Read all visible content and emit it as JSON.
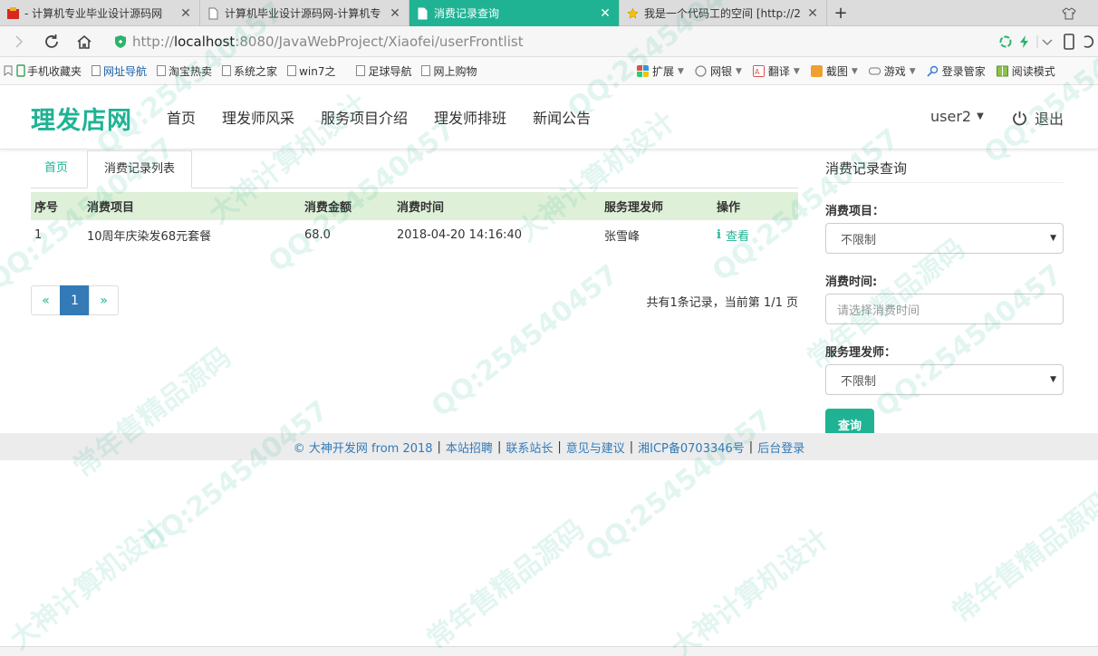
{
  "browser": {
    "tabs": [
      {
        "title": "- 计算机专业毕业设计源码网",
        "active": false
      },
      {
        "title": "计算机毕业设计源码网-计算机专",
        "active": false
      },
      {
        "title": "消费记录查询",
        "active": true
      },
      {
        "title": "我是一个代码工的空间 [http://2",
        "active": false
      }
    ],
    "new_tab": "+",
    "url_prefix": "http://",
    "url_host": "localhost",
    "url_rest": ":8080/JavaWebProject/Xiaofei/userFrontlist"
  },
  "bookmarks": {
    "left": [
      "手机收藏夹",
      "网址导航",
      "淘宝热卖",
      "系统之家",
      "win7之",
      "足球导航",
      "网上购物"
    ],
    "right": [
      "扩展",
      "网银",
      "翻译",
      "截图",
      "游戏",
      "登录管家",
      "阅读模式"
    ]
  },
  "site": {
    "brand": "理发店网",
    "nav": [
      "首页",
      "理发师风采",
      "服务项目介绍",
      "理发师排班",
      "新闻公告"
    ],
    "user": "user2",
    "logout": "退出"
  },
  "content_tabs": {
    "home": "首页",
    "current": "消费记录列表"
  },
  "table": {
    "headers": [
      "序号",
      "消费项目",
      "消费金额",
      "消费时间",
      "服务理发师",
      "操作"
    ],
    "rows": [
      {
        "no": "1",
        "item": "10周年庆染发68元套餐",
        "amount": "68.0",
        "time": "2018-04-20 14:16:40",
        "barber": "张雪峰",
        "action": "查看"
      }
    ]
  },
  "pager": {
    "prev": "«",
    "current": "1",
    "next": "»",
    "info": "共有1条记录，当前第 1/1 页"
  },
  "sidebar": {
    "title": "消费记录查询",
    "item_label": "消费项目：",
    "item_value": "不限制",
    "time_label": "消费时间:",
    "time_placeholder": "请选择消费时间",
    "barber_label": "服务理发师：",
    "barber_value": "不限制",
    "query_button": "查询"
  },
  "footer": {
    "links": [
      "© 大神开发网 from 2018",
      "本站招聘",
      "联系站长",
      "意见与建议",
      "湘ICP备0703346号",
      "后台登录"
    ]
  },
  "watermark": [
    "QQ:254540457",
    "大神计算机设计",
    "常年售精品源码"
  ],
  "colors": {
    "accent": "#1fb394",
    "link": "#337ab7",
    "table_header": "#dff0d8"
  }
}
